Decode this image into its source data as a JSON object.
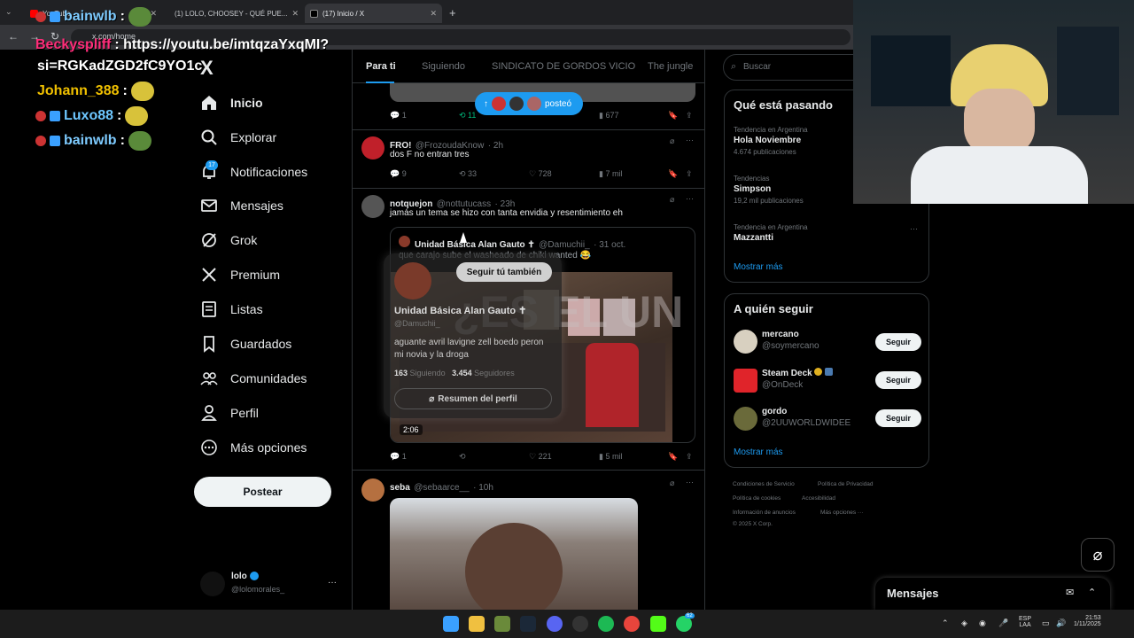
{
  "browser": {
    "tabs": [
      {
        "label": "YouTube"
      },
      {
        "label": "(1) LOLO, CHOOSEY - QUÉ PUE..."
      },
      {
        "label": "(17) Inicio / X"
      }
    ],
    "new_tab": "+",
    "url": "x.com/home"
  },
  "chat": [
    {
      "user": "Beckyspliff",
      "text": ": https://youtu.be/imtqzaYxqMI?",
      "color": "#ff2d7a"
    },
    {
      "user": "",
      "text": "si=RGKadZGD2fC9YO1c",
      "color": "#ffffff"
    },
    {
      "user": "Johann_388",
      "text": ":",
      "color": "#f0c000"
    },
    {
      "user": "Luxo88",
      "text": ":",
      "color": "#6ec7ff"
    },
    {
      "user": "bainwlb",
      "text": ":",
      "color": "#7ecbff"
    }
  ],
  "chat_top": {
    "user": "bainwlb",
    "text": ":"
  },
  "sidebar": {
    "logo": "X",
    "notification_count": "17",
    "items": [
      {
        "label": "Inicio",
        "icon": "home-icon"
      },
      {
        "label": "Explorar",
        "icon": "search-icon"
      },
      {
        "label": "Notificaciones",
        "icon": "bell-icon"
      },
      {
        "label": "Mensajes",
        "icon": "mail-icon"
      },
      {
        "label": "Grok",
        "icon": "grok-icon"
      },
      {
        "label": "Premium",
        "icon": "x-icon"
      },
      {
        "label": "Listas",
        "icon": "list-icon"
      },
      {
        "label": "Guardados",
        "icon": "bookmark-icon"
      },
      {
        "label": "Comunidades",
        "icon": "people-icon"
      },
      {
        "label": "Perfil",
        "icon": "person-icon"
      },
      {
        "label": "Más opciones",
        "icon": "more-icon"
      }
    ],
    "post_button": "Postear",
    "account": {
      "name": "lolo",
      "handle": "@lolomorales_",
      "more": "···"
    }
  },
  "feed": {
    "tabs": [
      "Para ti",
      "Siguiendo",
      "SINDICATO DE GORDOS VICIO",
      "The jungle"
    ],
    "posted_pill": "posteó",
    "post0": {
      "replies": "1",
      "reposts": "11",
      "views": "677"
    },
    "post1": {
      "name": "FRO!",
      "handle": "@FrozoudaKnow",
      "time": "· 2h",
      "text": "dos F no entran tres",
      "replies": "9",
      "reposts": "33",
      "likes": "728",
      "views": "7 mil"
    },
    "post2": {
      "name": "notquejon",
      "handle": "@nottutucass",
      "time": "· 23h",
      "text": "jamás un tema se hizo con tanta envidia y resentimiento eh",
      "quote": {
        "name": "Unidad Básica Alan Gauto ✝",
        "handle": "@Damuchii_",
        "time": "· 31 oct.",
        "text": "que carajo sube el washeado de chiki wanted 😂",
        "video_time": "2:06",
        "overlay_text": "¿ES EL UN ER?"
      },
      "replies": "1",
      "likes": "221",
      "views": "5 mil"
    },
    "post3": {
      "name": "seba",
      "handle": "@sebaarce__",
      "time": "· 10h"
    }
  },
  "hovercard": {
    "follow_label": "Seguir tú también",
    "name": "Unidad Básica Alan Gauto ✝",
    "handle": "@Damuchii_",
    "bio": "aguante avril lavigne zell boedo peron mi novia y la droga",
    "following_count": "163",
    "following_label": "Siguiendo",
    "followers_count": "3.454",
    "followers_label": "Seguidores",
    "summary_button": "Resumen del perfil"
  },
  "right": {
    "search_placeholder": "Buscar",
    "trends_title": "Qué está pasando",
    "trends": [
      {
        "context": "Tendencia en Argentina",
        "name": "Hola Noviembre",
        "count": "4.674 publicaciones"
      },
      {
        "context": "Tendencias",
        "name": "Simpson",
        "count": "19,2 mil publicaciones"
      },
      {
        "context": "Tendencia en Argentina",
        "name": "Mazzantti",
        "count": ""
      }
    ],
    "show_more": "Mostrar más",
    "who_title": "A quién seguir",
    "who": [
      {
        "name": "mercano",
        "handle": "@soymercano",
        "button": "Seguir"
      },
      {
        "name": "Steam Deck",
        "handle": "@OnDeck",
        "button": "Seguir"
      },
      {
        "name": "gordo",
        "handle": "@2UUWORLDWIDEE",
        "button": "Seguir"
      }
    ],
    "who_more": "Mostrar más",
    "footer": [
      "Condiciones de Servicio",
      "Política de Privacidad",
      "Política de cookies",
      "Accesibilidad",
      "Información de anuncios",
      "Más opciones ···",
      "© 2025 X Corp."
    ],
    "messages_label": "Mensajes"
  },
  "taskbar": {
    "lang1": "ESP",
    "lang2": "LAA",
    "time": "21:53",
    "date": "1/11/2025",
    "whatsapp_badge": "62"
  }
}
